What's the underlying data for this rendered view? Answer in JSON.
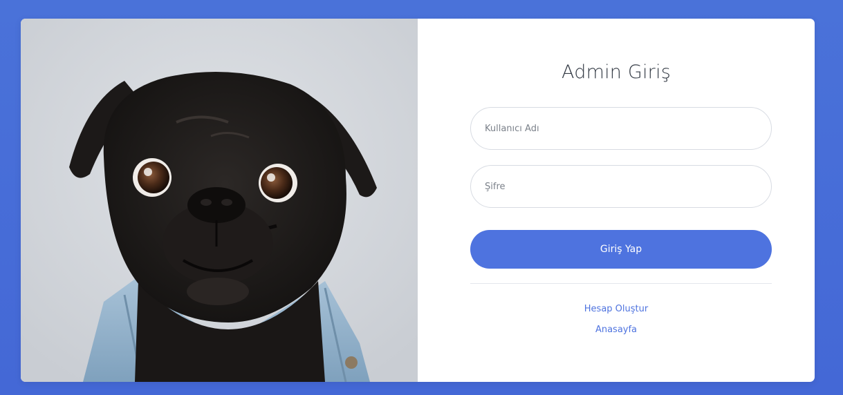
{
  "login": {
    "title": "Admin Giriş",
    "username_placeholder": "Kullanıcı Adı",
    "password_placeholder": "Şifre",
    "submit_label": "Giriş Yap",
    "create_account_label": "Hesap Oluştur",
    "home_label": "Anasayfa"
  },
  "image": {
    "icon": "pug-photo"
  },
  "colors": {
    "page_background": "#4a72d9",
    "accent": "#4e73df",
    "card": "#ffffff"
  }
}
